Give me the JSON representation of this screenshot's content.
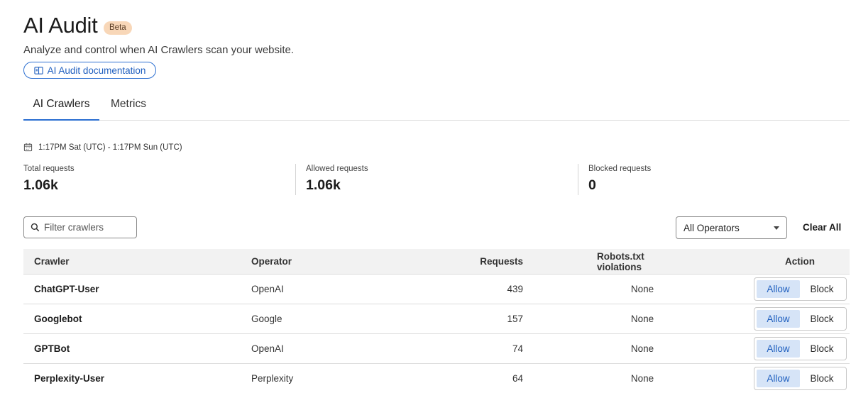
{
  "header": {
    "title": "AI Audit",
    "badge": "Beta",
    "subtitle": "Analyze and control when AI Crawlers scan your website.",
    "doc_link": "AI Audit documentation"
  },
  "tabs": [
    {
      "label": "AI Crawlers",
      "active": true
    },
    {
      "label": "Metrics",
      "active": false
    }
  ],
  "date_range": "1:17PM Sat (UTC) - 1:17PM Sun (UTC)",
  "stats": [
    {
      "label": "Total requests",
      "value": "1.06k"
    },
    {
      "label": "Allowed requests",
      "value": "1.06k"
    },
    {
      "label": "Blocked requests",
      "value": "0"
    }
  ],
  "filter": {
    "placeholder": "Filter crawlers",
    "value": ""
  },
  "operator_select": {
    "selected": "All Operators"
  },
  "clear_all": "Clear All",
  "table": {
    "columns": [
      "Crawler",
      "Operator",
      "Requests",
      "Robots.txt violations",
      "Action"
    ],
    "rows": [
      {
        "crawler": "ChatGPT-User",
        "operator": "OpenAI",
        "requests": "439",
        "robots": "None",
        "allow": "Allow",
        "block": "Block",
        "selected": "Allow"
      },
      {
        "crawler": "Googlebot",
        "operator": "Google",
        "requests": "157",
        "robots": "None",
        "allow": "Allow",
        "block": "Block",
        "selected": "Allow"
      },
      {
        "crawler": "GPTBot",
        "operator": "OpenAI",
        "requests": "74",
        "robots": "None",
        "allow": "Allow",
        "block": "Block",
        "selected": "Allow"
      },
      {
        "crawler": "Perplexity-User",
        "operator": "Perplexity",
        "requests": "64",
        "robots": "None",
        "allow": "Allow",
        "block": "Block",
        "selected": "Allow"
      }
    ]
  },
  "colors": {
    "accent": "#2c6fd1",
    "badge_bg": "#f8d7b8",
    "allow_selected_bg": "#d6e4f7",
    "header_bg": "#f2f2f2"
  },
  "icons": {
    "doc_link": "book-icon",
    "date_range": "calendar-icon",
    "filter": "search-icon",
    "select": "caret-down-icon"
  }
}
